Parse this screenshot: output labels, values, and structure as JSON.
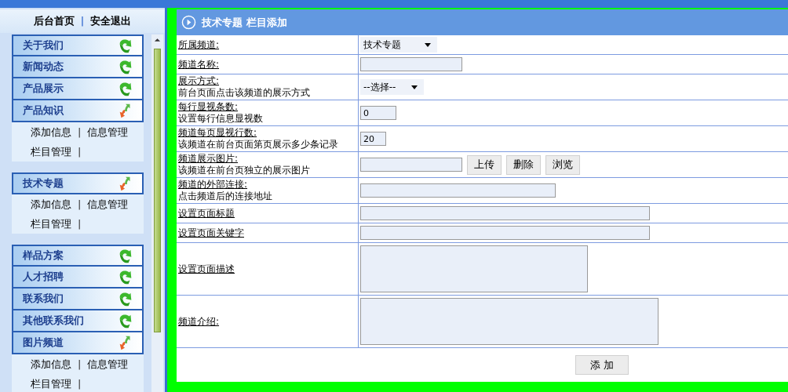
{
  "top_links": [
    {
      "label": "后台首页"
    },
    {
      "label": "安全退出"
    }
  ],
  "top_separator": "|",
  "sidebar": {
    "groups": [
      {
        "items": [
          {
            "label": "关于我们",
            "expanded": false
          },
          {
            "label": "新闻动态",
            "expanded": false
          },
          {
            "label": "产品展示",
            "expanded": false
          },
          {
            "label": "产品知识",
            "expanded": true,
            "sub_rows": [
              [
                {
                  "kind": "link",
                  "text": "添加信息"
                },
                {
                  "kind": "sep",
                  "text": "|"
                },
                {
                  "kind": "link",
                  "text": "信息管理"
                }
              ],
              [
                {
                  "kind": "link",
                  "text": "栏目管理"
                },
                {
                  "kind": "sep",
                  "text": "|"
                }
              ]
            ]
          }
        ]
      },
      {
        "items": [
          {
            "label": "技术专题",
            "expanded": true,
            "sub_rows": [
              [
                {
                  "kind": "link",
                  "text": "添加信息"
                },
                {
                  "kind": "sep",
                  "text": "|"
                },
                {
                  "kind": "link",
                  "text": "信息管理"
                }
              ],
              [
                {
                  "kind": "link",
                  "text": "栏目管理"
                },
                {
                  "kind": "sep",
                  "text": "|"
                }
              ]
            ]
          }
        ]
      },
      {
        "items": [
          {
            "label": "样品方案",
            "expanded": false
          },
          {
            "label": "人才招聘",
            "expanded": false
          },
          {
            "label": "联系我们",
            "expanded": false
          },
          {
            "label": "其他联系我们",
            "expanded": false
          },
          {
            "label": "图片频道",
            "expanded": true,
            "sub_rows": [
              [
                {
                  "kind": "link",
                  "text": "添加信息"
                },
                {
                  "kind": "sep",
                  "text": "|"
                },
                {
                  "kind": "link",
                  "text": "信息管理"
                }
              ],
              [
                {
                  "kind": "link",
                  "text": "栏目管理"
                },
                {
                  "kind": "sep",
                  "text": "|"
                }
              ]
            ]
          }
        ]
      }
    ]
  },
  "panel": {
    "title": "技术专题 栏目添加",
    "rows": [
      {
        "label": "所属频道:",
        "field": {
          "kind": "select",
          "value": "技术专题"
        }
      },
      {
        "label": "频道名称:",
        "field": {
          "kind": "input"
        }
      },
      {
        "label": "展示方式:",
        "hint": "前台页面点击该频道的展示方式",
        "field": {
          "kind": "select",
          "value": "--选择--"
        }
      },
      {
        "label": "每行显视条数:",
        "hint": "设置每行信息显视数",
        "field": {
          "kind": "input",
          "value": "0"
        }
      },
      {
        "label": "频道每页显视行数:",
        "hint": "该频道在前台页面第页展示多少条记录",
        "field": {
          "kind": "input",
          "value": "20"
        }
      },
      {
        "label": "频道展示图片:",
        "hint": "该频道在前台页独立的展示图片",
        "field": {
          "kind": "upload",
          "buttons": [
            "上传",
            "删除",
            "浏览"
          ]
        }
      },
      {
        "label": "频道的外部连接:",
        "hint": "点击频道后的连接地址",
        "field": {
          "kind": "input"
        }
      },
      {
        "label": "设置页面标题",
        "field": {
          "kind": "input"
        }
      },
      {
        "label": "设置页面关键字",
        "field": {
          "kind": "input"
        }
      },
      {
        "label": "设置页面描述",
        "field": {
          "kind": "textarea"
        }
      },
      {
        "label": "频道介绍:",
        "field": {
          "kind": "textarea"
        }
      }
    ],
    "submit": "添 加"
  }
}
